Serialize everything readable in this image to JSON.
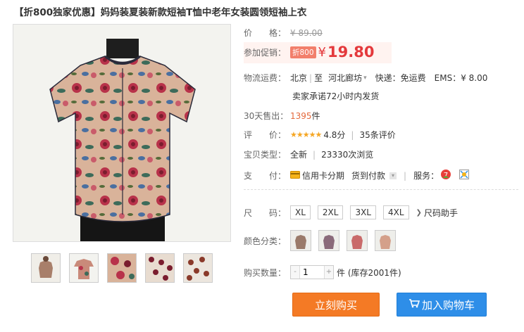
{
  "title": {
    "promo": "【折800独家优惠】",
    "name": "妈妈装夏装新款短袖T恤中老年女装圆领短袖上衣"
  },
  "price": {
    "label": "价　　格：",
    "original": "¥ 89.00"
  },
  "promotion": {
    "label": "参加促销：",
    "badge": "折800",
    "yen": "¥",
    "price": "19.80"
  },
  "shipping": {
    "label": "物流运费：",
    "from": "北京",
    "sep": "|",
    "to": "至",
    "dest": "河北廊坊",
    "express": "快递：免运费",
    "ems": "EMS：¥ 8.00",
    "promise": "卖家承诺72小时内发货"
  },
  "sales": {
    "label": "30天售出：",
    "count": "1395",
    "unit": "件"
  },
  "rating": {
    "label": "评　　价：",
    "stars": "★★★★★",
    "score": "4.8分",
    "reviews": "35条评价"
  },
  "item_type": {
    "label": "宝贝类型：",
    "condition": "全新",
    "views": "23330次浏览"
  },
  "payment": {
    "label": "支　　付：",
    "credit": "信用卡分期",
    "cod": "货到付款",
    "service_label": "服务："
  },
  "size": {
    "label": "尺　　码：",
    "options": [
      "XL",
      "2XL",
      "3XL",
      "4XL"
    ],
    "helper": "尺码助手"
  },
  "color": {
    "label": "颜色分类："
  },
  "quantity": {
    "label": "购买数量：",
    "value": "1",
    "minus": "-",
    "plus": "+",
    "stock": "件 (库存2001件)"
  },
  "buttons": {
    "buy_now": "立刻购买",
    "add_cart": "加入购物车"
  },
  "colors": {
    "price_red": "#e4393c",
    "buy_orange": "#f47a25",
    "cart_blue": "#2e8ee8"
  },
  "icons": {
    "credit": "credit-card-icon",
    "cart": "shopping-cart-icon",
    "service1": "service-badge-icon",
    "service2": "guarantee-icon"
  }
}
